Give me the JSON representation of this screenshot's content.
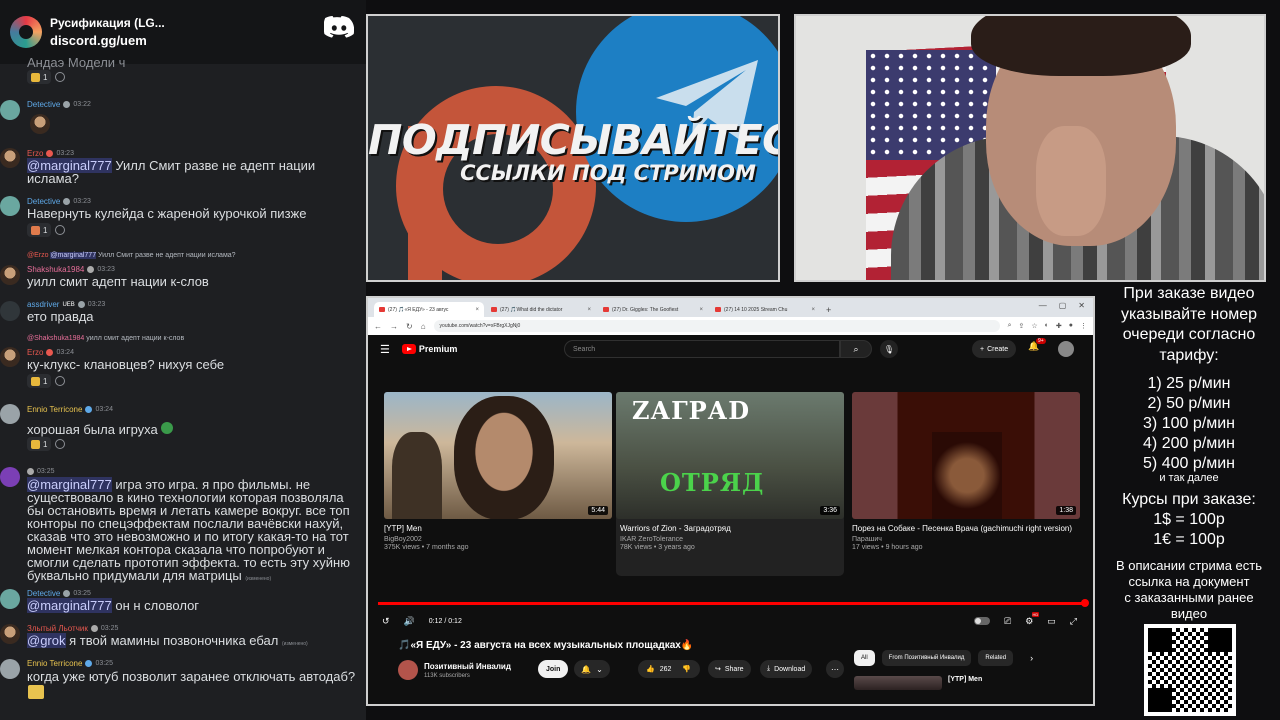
{
  "chat": {
    "server_name": "Русификация (LG...",
    "invite": "discord.gg/uem",
    "top_partial_text": "Андаэ Модели ч",
    "top_reaction_count": "1",
    "messages": [
      {
        "user": "Detective",
        "time": "03:22",
        "name_color": "#5fa9e8",
        "body": ""
      },
      {
        "user": "Erzo",
        "time": "03:23",
        "name_color": "#e8584f",
        "mention": "@marginal777",
        "body": " Уилл Смит разве не адепт нации\nислама?"
      },
      {
        "user": "Detective",
        "time": "03:23",
        "name_color": "#5fa9e8",
        "body": "Навернуть кулейда с жареной курочкой пизже",
        "reaction": "1"
      },
      {
        "user": "Shakshuka1984",
        "time": "03:23",
        "name_color": "#e86f9a",
        "reply_user": "@Erzo",
        "reply_mention": "@marginal777",
        "reply_text": " Уилл Смит разве не адепт нации ислама?",
        "body": "уилл смит адепт нации к-слов"
      },
      {
        "user": "assdriver",
        "time": "03:23",
        "name_color": "#5fa9e8",
        "tag": "UEB",
        "body": "ето правда"
      },
      {
        "user": "Erzo",
        "time": "03:24",
        "name_color": "#e8584f",
        "reply_user": "@Shakshuka1984",
        "reply_text": " уилл смит адепт нации к-слов",
        "body": "ку-клукс- клановцев? нихуя себе",
        "reaction": "1"
      },
      {
        "user": "Ennio Terricone",
        "time": "03:24",
        "name_color": "#e8c34f",
        "body": "хорошая была игруха",
        "reaction": "1"
      },
      {
        "user": "",
        "time": "03:25",
        "name_color": "#b5bac1",
        "mention": "@marginal777",
        "body": " игра это игра. я про фильмы. не\nсуществовало в кино технологии которая позволяла\nбы остановить время и летать камере вокруг. все топ\nконторы по спецэффектам послали вачёвски нахуй,\nсказав что это невозможно и по итогу какая-то на тот\nмомент мелкая контора сказала что попробуют и\nсмогли сделать прототип эффекта. то есть эту хуйню\nбуквально придумали для матрицы",
        "edited": "(изменено)"
      },
      {
        "user": "Detective",
        "time": "03:25",
        "name_color": "#5fa9e8",
        "mention": "@marginal777",
        "body": " он н словолог"
      },
      {
        "user": "Злытый Льотчик",
        "time": "03:25",
        "name_color": "#e8584f",
        "mention": "@grok",
        "body": " я твой мамины позвоночника ебал",
        "edited": "(изменено)"
      },
      {
        "user": "Ennio Terricone",
        "time": "03:25",
        "name_color": "#e8c34f",
        "body": "когда уже ютуб позволит заранее отключать автодаб?"
      }
    ]
  },
  "promo": {
    "title": "ПОДПИСЫВАЙТЕСЬ",
    "subtitle": "ССЫЛКИ ПОД СТРИМОМ"
  },
  "browser": {
    "tabs": [
      {
        "label": "(27) 🎵«Я ЕДУ» - 23 авгус"
      },
      {
        "label": "(27) 🎵What did the dictator"
      },
      {
        "label": "(27) Dr. Giggles: The Goofiest"
      },
      {
        "label": "(27) 14 10 2025 Stream Chu"
      }
    ],
    "url": "youtube.com/watch?v=xFBrgXJgNj0",
    "youtube": {
      "logo": "Premium",
      "search_placeholder": "Search",
      "create": "Create",
      "notif": "9+",
      "endcards": [
        {
          "title": "[YTP] Men",
          "channel": "BigBoy2002",
          "meta": "375K views • 7 months ago",
          "duration": "5:44"
        },
        {
          "title": "Warriors of Zion - Заградотряд",
          "channel": "IKAR ZeroTolerance",
          "meta": "78K views • 3 years ago",
          "duration": "3:36",
          "overlay_top": "ZАГРАD",
          "overlay_bottom": "ОТРЯД"
        },
        {
          "title": "Порез на Собаке - Песенка Врача (gachimuchi right version)",
          "channel": "Парашич",
          "meta": "17 views • 9 hours ago",
          "duration": "1:38"
        }
      ],
      "progress": 1.0,
      "time": "0:12 / 0:12",
      "video_title": "🎵«Я ЕДУ» - 23 августа на всех музыкальных площадках🔥",
      "channel_name": "Позитивный Инвалид",
      "subscribers": "113K subscribers",
      "join": "Join",
      "likes": "262",
      "share": "Share",
      "download": "Download",
      "chips": [
        "All",
        "From Позитивный Инвалид",
        "Related"
      ],
      "rec_title": "[YTP] Men"
    }
  },
  "prices": {
    "intro": [
      "При заказе видео",
      "указывайте номер",
      "очереди согласно",
      "тарифу:"
    ],
    "tiers": [
      "1) 25 р/мин",
      "2) 50 р/мин",
      "3) 100 р/мин",
      "4) 200 р/мин",
      "5) 400 р/мин"
    ],
    "etc": "и так далее",
    "courses_heading": "Курсы при заказе:",
    "courses": [
      "1$ = 100р",
      "1€ = 100р"
    ],
    "note": [
      "В описании стрима есть",
      "ссылка на документ",
      "с заказанными ранее",
      "видео"
    ]
  },
  "colors": {
    "accent_red": "#ff0000",
    "discord_bg": "#1e1f22",
    "mention_bg": "#5865f2"
  }
}
